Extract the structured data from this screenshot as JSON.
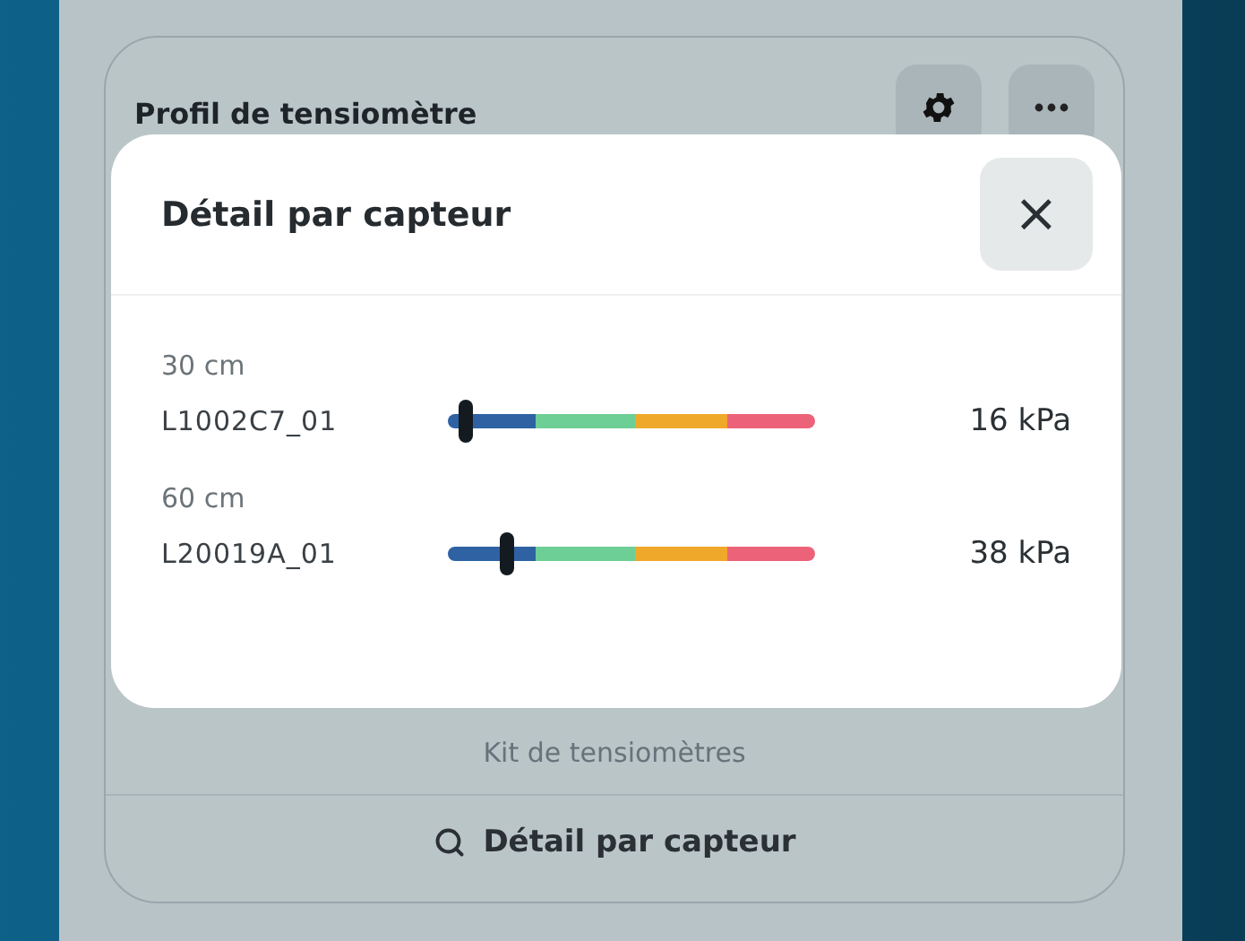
{
  "card": {
    "title": "Profil de tensiomètre",
    "footer_text": "Kit de tensiomètres",
    "footer_button": {
      "label": "Détail par capteur"
    }
  },
  "dialog": {
    "title": "Détail par capteur",
    "close_label": "×",
    "sensors": [
      {
        "depth": "30 cm",
        "name": "L1002C7_01",
        "level": 0.05,
        "reading": "16 kPa"
      },
      {
        "depth": "60 cm",
        "name": "L20019A_01",
        "level": 0.16,
        "reading": "38 kPa"
      }
    ]
  }
}
